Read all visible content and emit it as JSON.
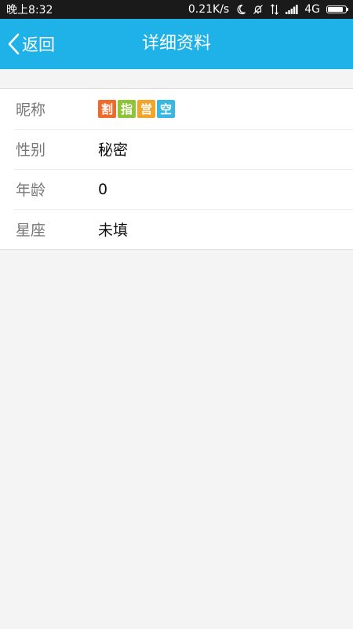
{
  "status_bar": {
    "time": "晚上8:32",
    "net_speed": "0.21K/s",
    "network": "4G",
    "battery_level": 0.85,
    "icons": [
      "moon-icon",
      "silent-bell-icon",
      "data-arrows-icon",
      "signal-icon",
      "battery-icon"
    ]
  },
  "nav": {
    "back_label": "返回",
    "title": "详细资料",
    "background_color": "#1fb2e9"
  },
  "profile": {
    "nickname": {
      "label": "昵称",
      "chars": [
        {
          "text": "割",
          "color": "#f06a2a"
        },
        {
          "text": "指",
          "color": "#8fc33a"
        },
        {
          "text": "営",
          "color": "#f3a52b"
        },
        {
          "text": "空",
          "color": "#36b8e3"
        }
      ]
    },
    "gender": {
      "label": "性别",
      "value": "秘密"
    },
    "age": {
      "label": "年龄",
      "value": "0"
    },
    "zodiac": {
      "label": "星座",
      "value": "未填"
    }
  }
}
